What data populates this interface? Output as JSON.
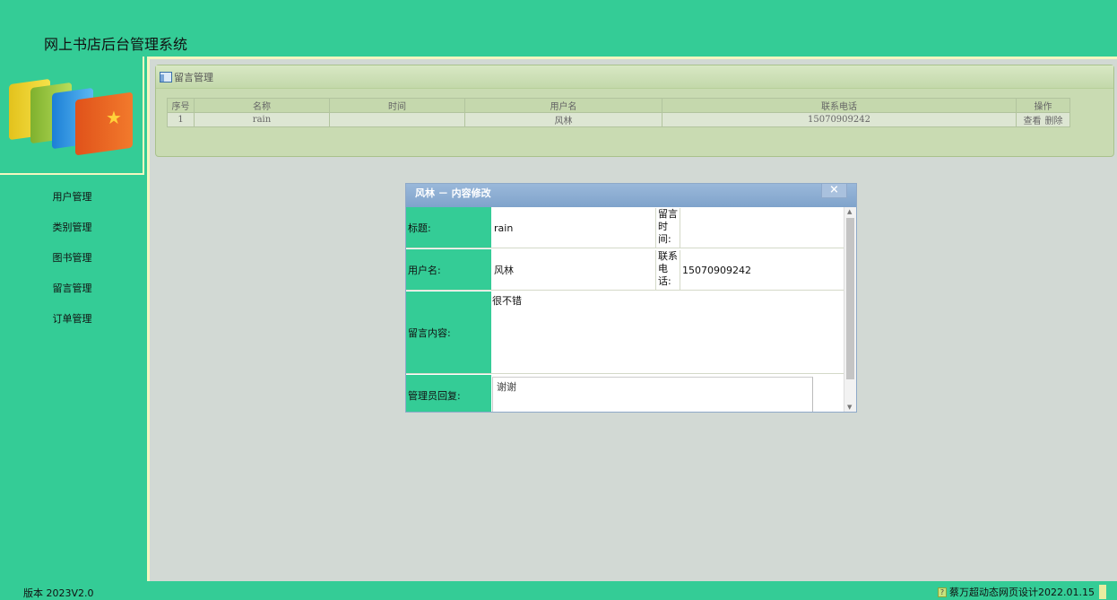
{
  "app": {
    "title": "网上书店后台管理系统",
    "version": "版本 2023V2.0",
    "credit": "蔡万超动态网页设计2022.01.15"
  },
  "sidebar": {
    "items": [
      {
        "label": "用户管理"
      },
      {
        "label": "类别管理"
      },
      {
        "label": "图书管理"
      },
      {
        "label": "留言管理"
      },
      {
        "label": "订单管理"
      }
    ]
  },
  "panel": {
    "title": "留言管理",
    "columns": [
      "序号",
      "名称",
      "时间",
      "用户名",
      "联系电话",
      "操作"
    ],
    "rows": [
      {
        "no": "1",
        "name": "rain",
        "time": "",
        "user": "风林",
        "phone": "15070909242",
        "view": "查看",
        "delete": "删除"
      }
    ]
  },
  "dialog": {
    "title": "风林 － 内容修改",
    "close_label": "×",
    "fields": {
      "title_label": "标题:",
      "title_value": "rain",
      "time_label": "留言时间:",
      "time_value": "",
      "user_label": "用户名:",
      "user_value": "风林",
      "phone_label": "联系电话:",
      "phone_value": "15070909242",
      "content_label": "留言内容:",
      "content_value": "很不错",
      "reply_label": "管理员回复:",
      "reply_value": "谢谢"
    }
  },
  "colors": {
    "background": "#34cc96",
    "main_area": "#d2d9d4",
    "dialog_header": "#8eb0d6"
  }
}
